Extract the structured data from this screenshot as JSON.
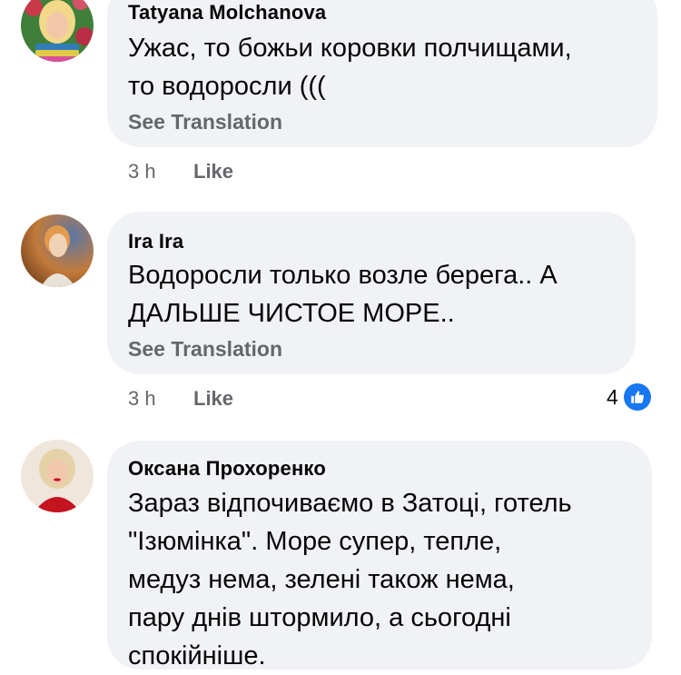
{
  "comments": [
    {
      "author": "Tatyana Molchanova",
      "avatar": "tatyana-avatar",
      "text_lines": [
        "Ужас, то божьи коровки полчищами,",
        "то водоросли ((("
      ],
      "see_translation": "See Translation",
      "time": "3 h",
      "like_label": "Like"
    },
    {
      "author": "Ira Ira",
      "avatar": "ira-avatar",
      "text_lines": [
        "Водоросли только возле берега.. А",
        "ДАЛЬШЕ ЧИСТОЕ МОРЕ.."
      ],
      "see_translation": "See Translation",
      "time": "3 h",
      "like_label": "Like",
      "reaction_count": "4",
      "reaction_icon": "thumbs-up-icon"
    },
    {
      "author": "Оксана Прохоренко",
      "avatar": "oksana-avatar",
      "text_lines": [
        "Зараз відпочиваємо в Затоці, готель",
        "\"Ізюмінка\". Море супер, тепле,",
        "медуз нема, зелені також нема,",
        "пару днів штормило, а сьогодні",
        "спокійніше."
      ]
    }
  ],
  "colors": {
    "bubble_bg": "#f0f2f5",
    "secondary_text": "#65676b",
    "like_blue": "#1877f2"
  }
}
